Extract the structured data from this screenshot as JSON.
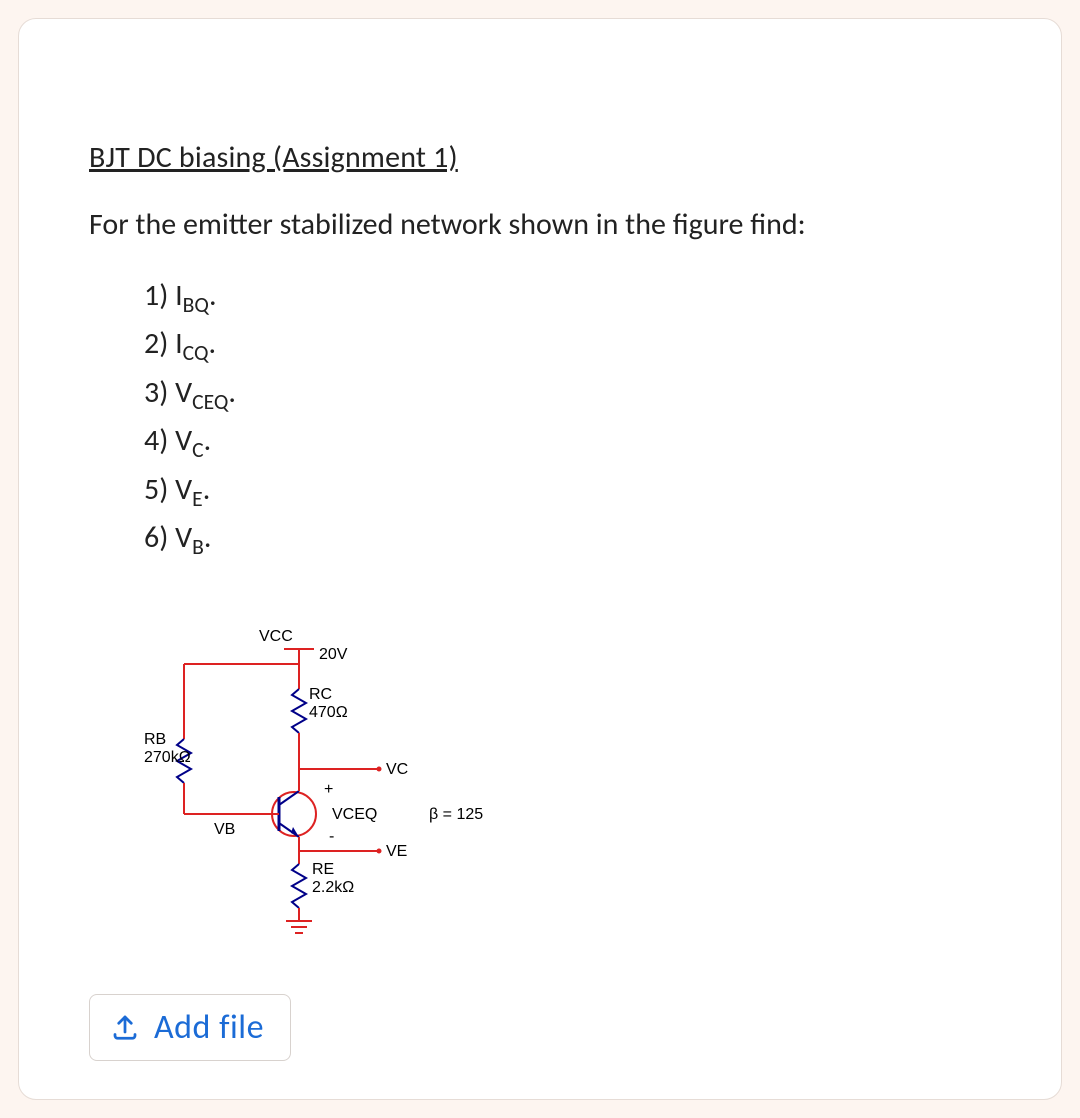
{
  "title": "BJT DC biasing  (Assignment 1)",
  "prompt": "For the emitter stabilized network shown in the figure find:",
  "items": [
    {
      "n": "1)",
      "sym": "I",
      "sub": "BQ",
      "tail": "."
    },
    {
      "n": "2)",
      "sym": "I",
      "sub": "CQ",
      "tail": "."
    },
    {
      "n": "3)",
      "sym": "V",
      "sub": "CEQ",
      "tail": "."
    },
    {
      "n": "4)",
      "sym": "V",
      "sub": "C",
      "tail": "."
    },
    {
      "n": "5)",
      "sym": "V",
      "sub": "E",
      "tail": "."
    },
    {
      "n": "6)",
      "sym": "V",
      "sub": "B",
      "tail": "."
    }
  ],
  "circuit": {
    "vcc_label": "VCC",
    "vcc_value": "20V",
    "rc_label": "RC",
    "rc_value": "470Ω",
    "rb_label": "RB",
    "rb_value": "270kΩ",
    "vb_label": "VB",
    "vc_label": "VC",
    "vceq_label": "VCEQ",
    "ve_label": "VE",
    "re_label": "RE",
    "re_value": "2.2kΩ",
    "beta_label": "β = 125",
    "plus": "+",
    "minus": "-"
  },
  "add_file_label": "Add file"
}
